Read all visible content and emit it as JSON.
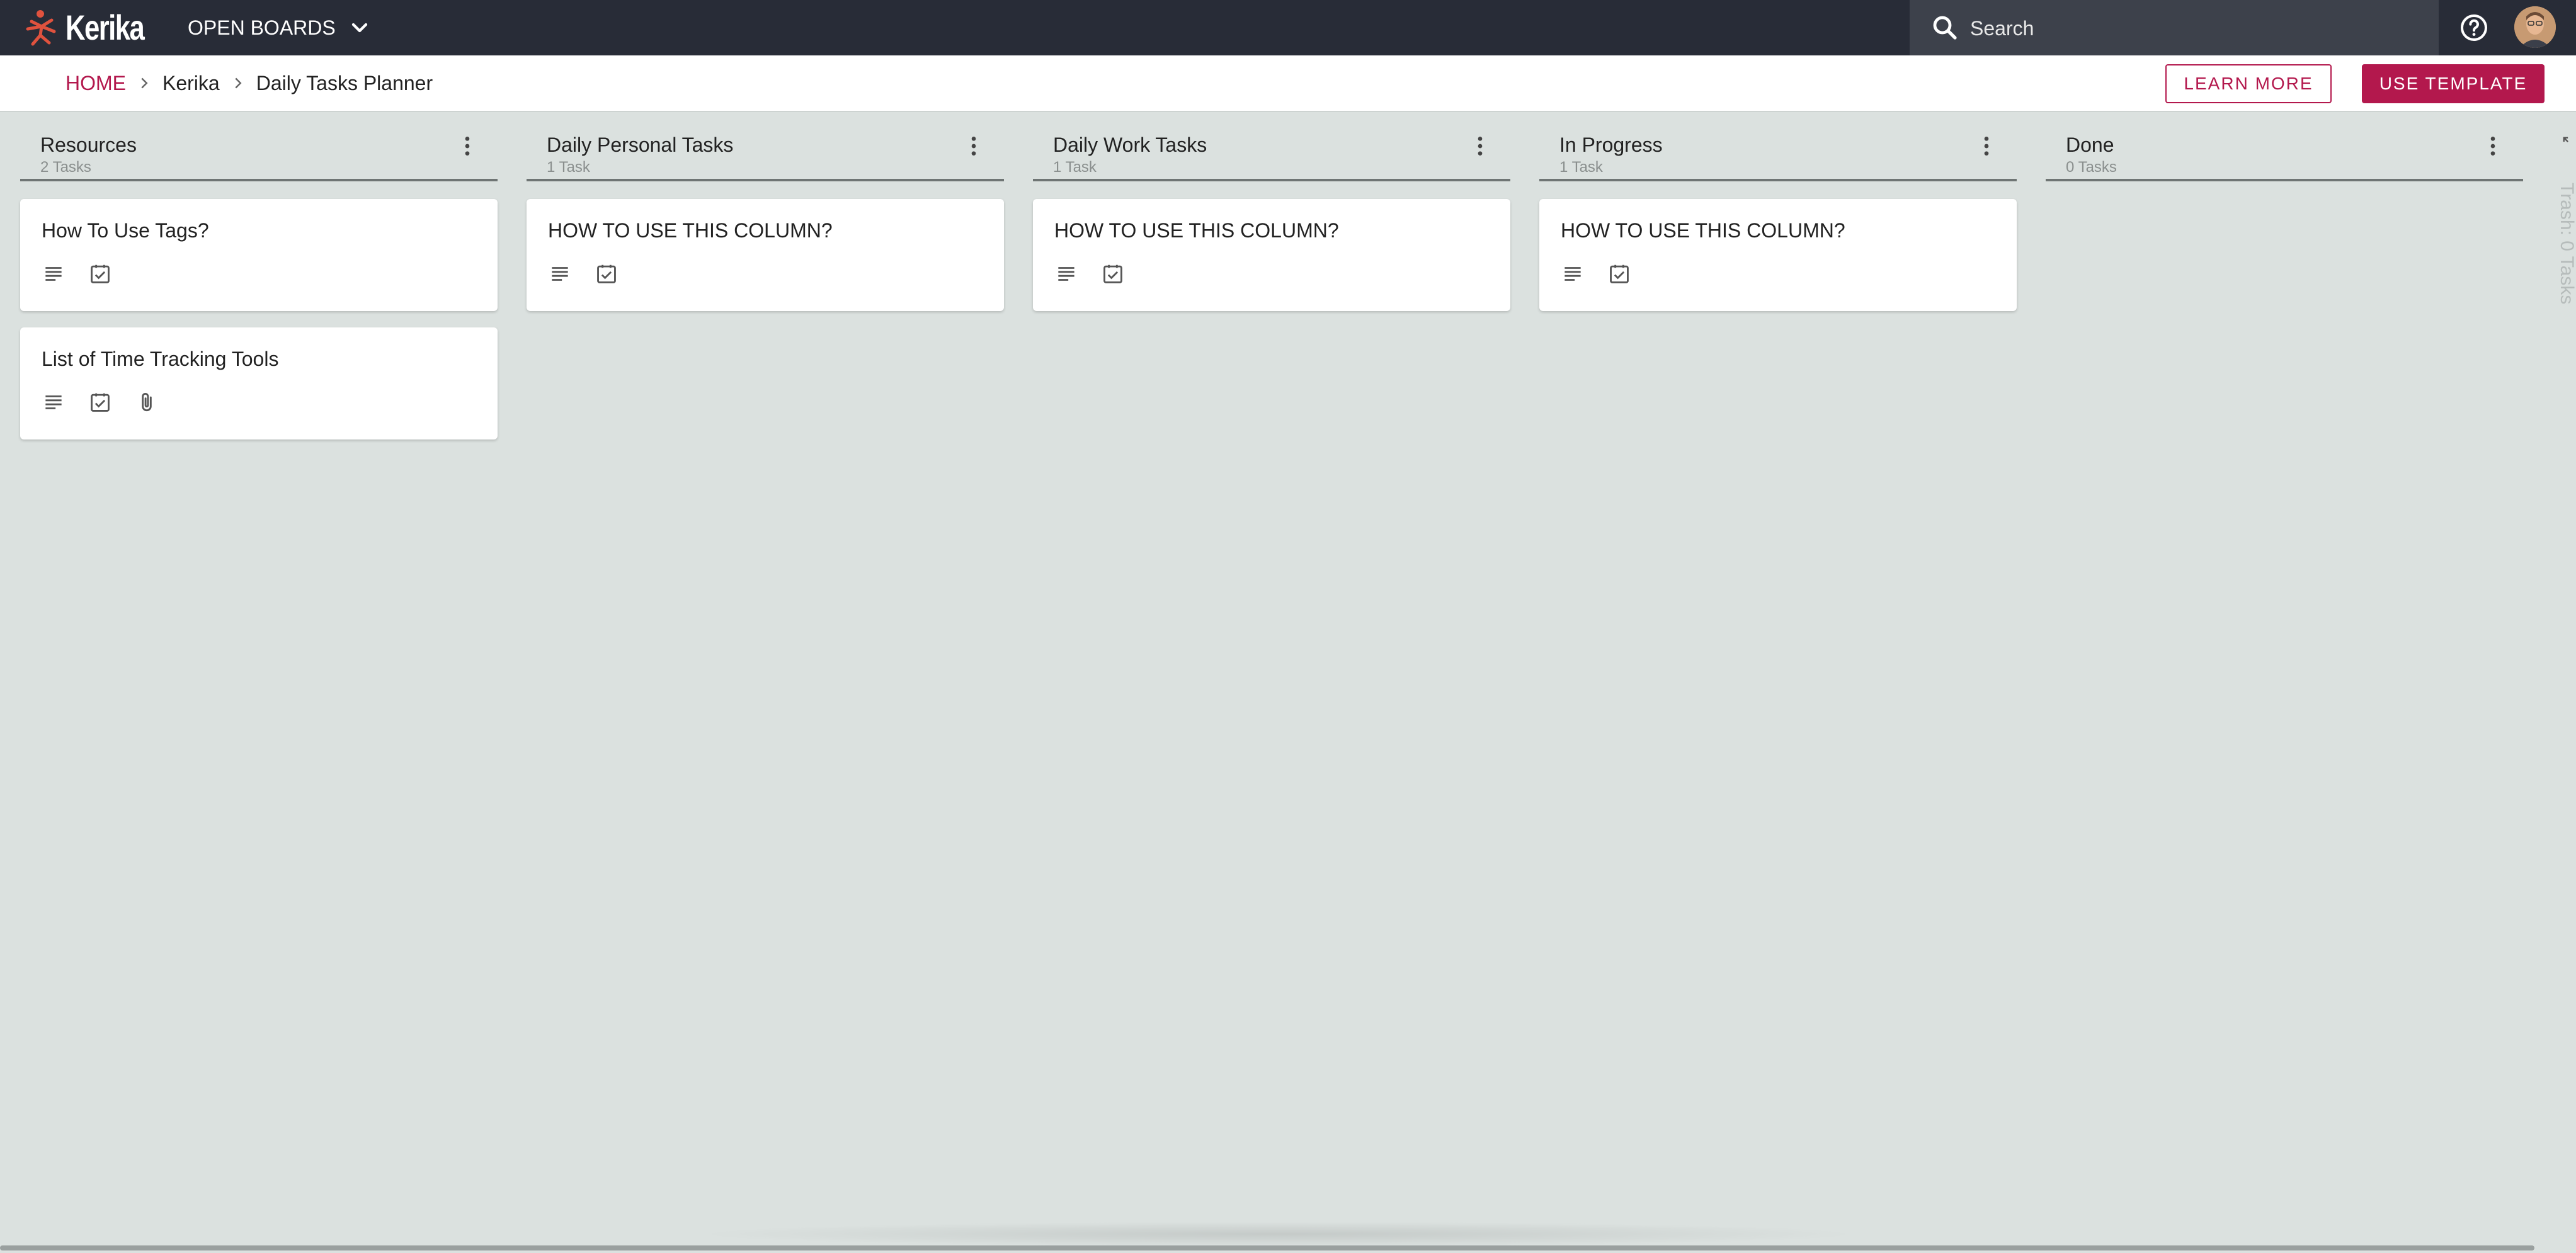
{
  "app": {
    "logo_text": "Kerika",
    "open_boards_label": "OPEN BOARDS"
  },
  "search": {
    "placeholder": "Search"
  },
  "breadcrumb": {
    "home": "HOME",
    "items": [
      "Kerika",
      "Daily Tasks Planner"
    ]
  },
  "actions": {
    "learn_more": "LEARN MORE",
    "use_template": "USE TEMPLATE"
  },
  "colors": {
    "accent": "#b3184d",
    "topbar": "#282c37",
    "board_bg": "#dbe1df"
  },
  "columns": [
    {
      "title": "Resources",
      "count": "2 Tasks",
      "cards": [
        {
          "title": "How To Use Tags?",
          "icons": [
            "description-icon",
            "checklist-icon"
          ]
        },
        {
          "title": "List of Time Tracking Tools",
          "icons": [
            "description-icon",
            "checklist-icon",
            "attachment-icon"
          ]
        }
      ]
    },
    {
      "title": "Daily Personal Tasks",
      "count": "1 Task",
      "cards": [
        {
          "title": "HOW TO USE THIS COLUMN?",
          "icons": [
            "description-icon",
            "checklist-icon"
          ]
        }
      ]
    },
    {
      "title": "Daily Work Tasks",
      "count": "1 Task",
      "cards": [
        {
          "title": "HOW TO USE THIS COLUMN?",
          "icons": [
            "description-icon",
            "checklist-icon"
          ]
        }
      ]
    },
    {
      "title": "In Progress",
      "count": "1 Task",
      "cards": [
        {
          "title": "HOW TO USE THIS COLUMN?",
          "icons": [
            "description-icon",
            "checklist-icon"
          ]
        }
      ]
    },
    {
      "title": "Done",
      "count": "0 Tasks",
      "cards": []
    }
  ],
  "trash": {
    "label": "Trash: 0 Tasks"
  }
}
